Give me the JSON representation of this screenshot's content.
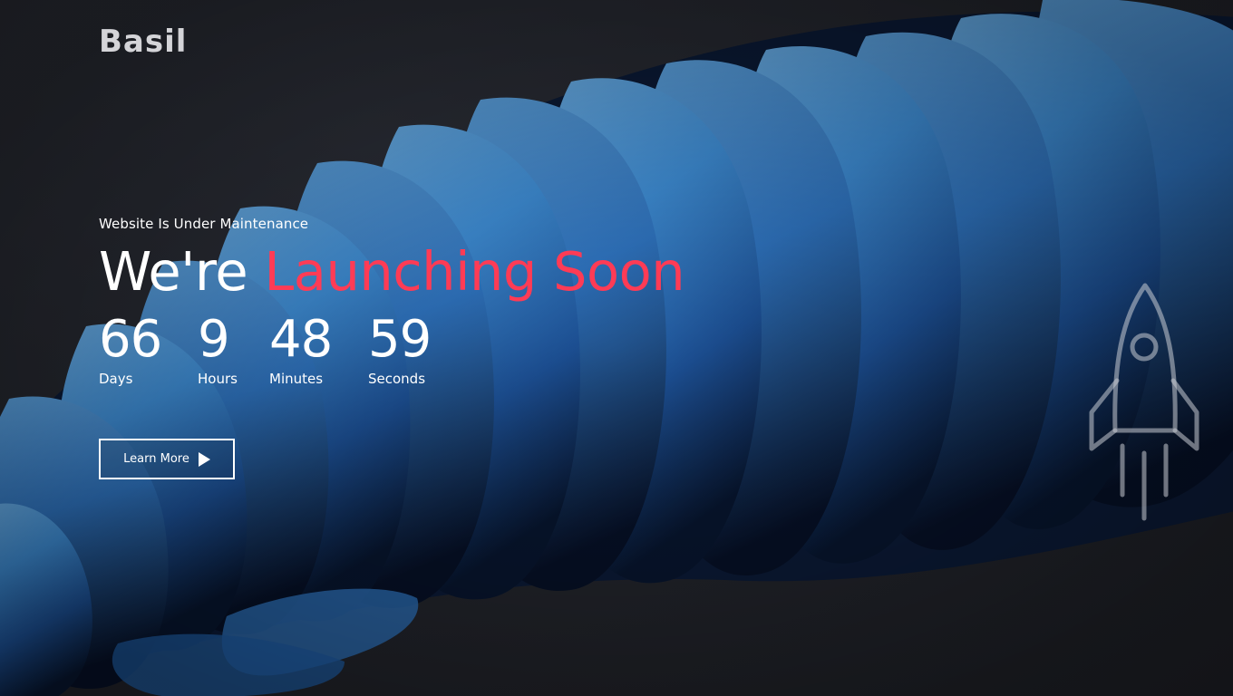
{
  "brand": {
    "logo_text": "Basil"
  },
  "hero": {
    "subtitle": "Website Is Under Maintenance",
    "headline_plain": "We're ",
    "headline_accent": "Launching Soon"
  },
  "countdown": {
    "days": {
      "value": "66",
      "label": "Days"
    },
    "hours": {
      "value": "9",
      "label": "Hours"
    },
    "minutes": {
      "value": "48",
      "label": "Minutes"
    },
    "seconds": {
      "value": "59",
      "label": "Seconds"
    }
  },
  "cta": {
    "label": "Learn More",
    "icon": "play-icon"
  },
  "decor": {
    "rocket_icon": "rocket-icon",
    "background": "blue-3d-wave-art"
  },
  "colors": {
    "accent": "#ff3b55",
    "background": "#23252d",
    "text": "#ffffff",
    "logo": "#d4d4d8",
    "art_blue": "#3d8fd6"
  }
}
